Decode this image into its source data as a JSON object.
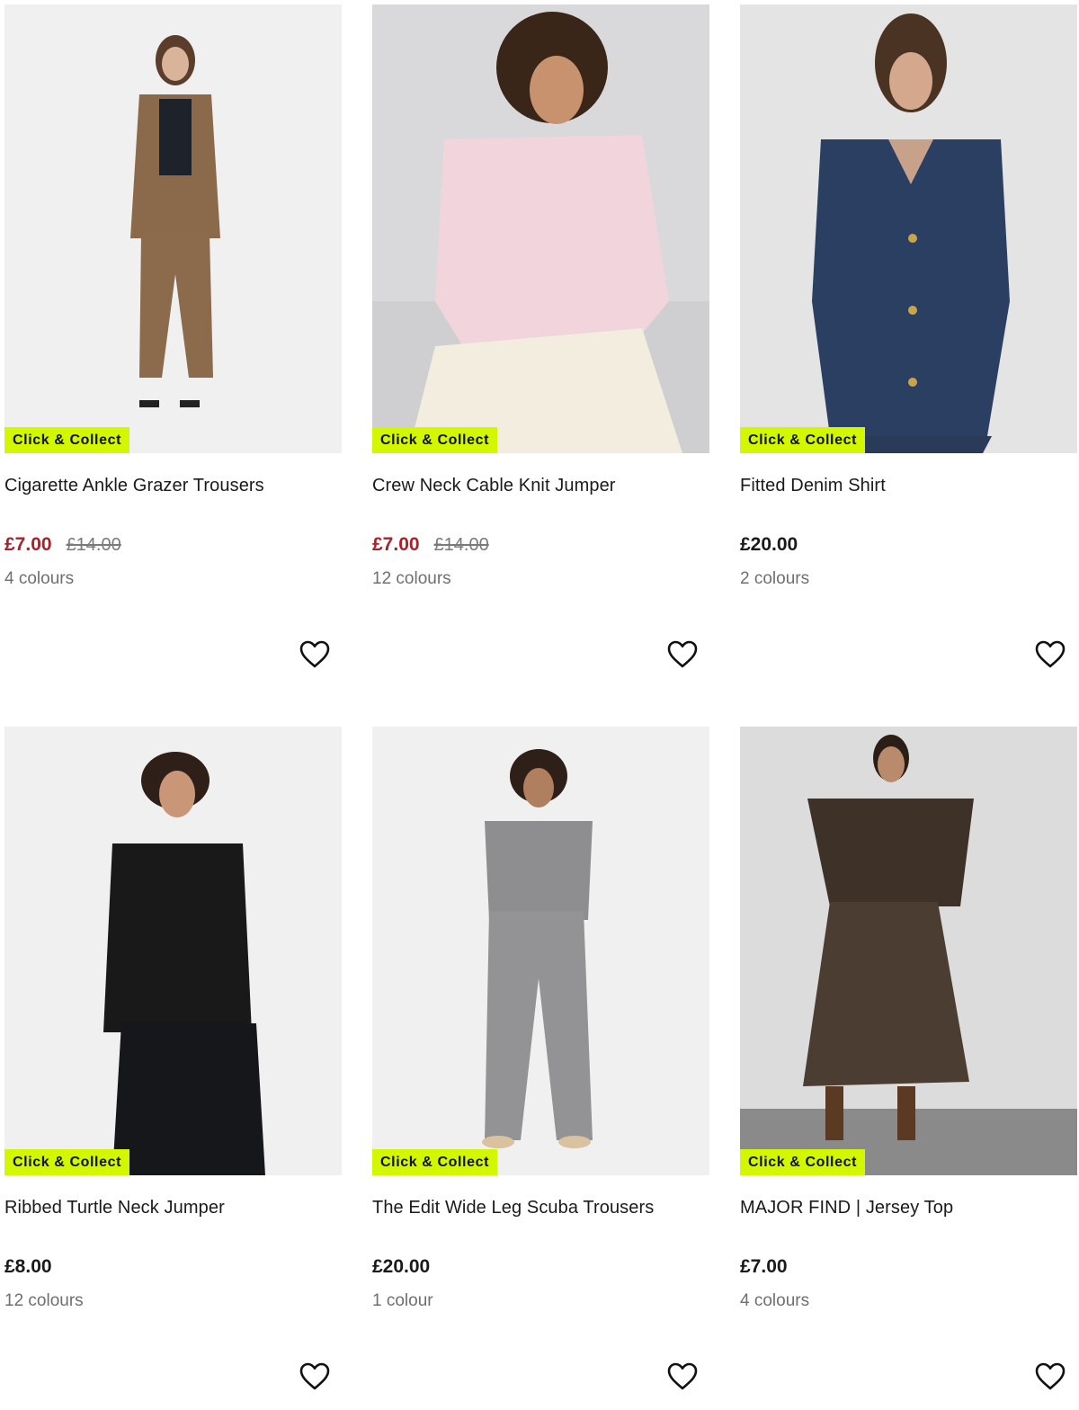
{
  "products": [
    {
      "badge": "Click & Collect",
      "name": "Cigarette Ankle Grazer Trousers",
      "price": "£7.00",
      "was_price": "£14.00",
      "colours": "4 colours",
      "on_sale": true
    },
    {
      "badge": "Click & Collect",
      "name": "Crew Neck Cable Knit Jumper",
      "price": "£7.00",
      "was_price": "£14.00",
      "colours": "12 colours",
      "on_sale": true
    },
    {
      "badge": "Click & Collect",
      "name": "Fitted Denim Shirt",
      "price": "£20.00",
      "was_price": "",
      "colours": "2 colours",
      "on_sale": false
    },
    {
      "badge": "Click & Collect",
      "name": "Ribbed Turtle Neck Jumper",
      "price": "£8.00",
      "was_price": "",
      "colours": "12 colours",
      "on_sale": false
    },
    {
      "badge": "Click & Collect",
      "name": "The Edit Wide Leg Scuba Trousers",
      "price": "£20.00",
      "was_price": "",
      "colours": "1 colour",
      "on_sale": false
    },
    {
      "badge": "Click & Collect",
      "name": "MAJOR FIND | Jersey Top",
      "price": "£7.00",
      "was_price": "",
      "colours": "4 colours",
      "on_sale": false
    }
  ],
  "icons": {
    "wishlist": "heart-outline-icon"
  },
  "colors": {
    "badge_bg": "#d2f700",
    "sale_price": "#a8222c",
    "text": "#1a1a1a",
    "muted": "#6f6f6f"
  }
}
